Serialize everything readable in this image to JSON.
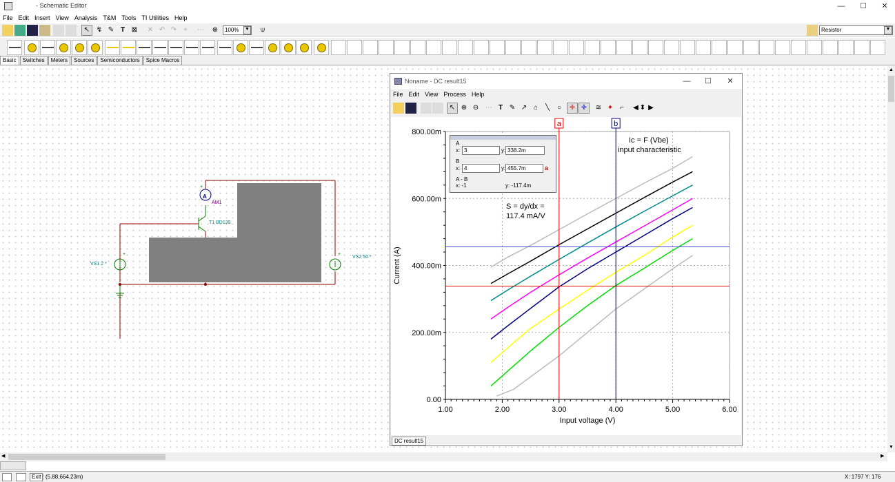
{
  "app": {
    "title": "- Schematic Editor",
    "window_controls": [
      "—",
      "☐",
      "✕"
    ]
  },
  "menu": [
    "File",
    "Edit",
    "Insert",
    "View",
    "Analysis",
    "T&M",
    "Tools",
    "TI Utilities",
    "Help"
  ],
  "toolbar": {
    "zoom": "100%",
    "component": "Resistor"
  },
  "component_tabs": [
    "Basic",
    "Switches",
    "Meters",
    "Sources",
    "Semiconductors",
    "Spice Macros"
  ],
  "schematic": {
    "ammeter_symbol": "A",
    "ammeter": "AM1",
    "transistor": "T1 BD139",
    "vs1": "VS1 2 *",
    "vs2": "VS2 50 *",
    "plus": "+"
  },
  "dc": {
    "title": "Noname - DC result15",
    "menu": [
      "File",
      "Edit",
      "View",
      "Process",
      "Help"
    ],
    "tab": "DC result15",
    "cursor": {
      "a_title": "A",
      "a_x_label": "x:",
      "a_x": "3",
      "a_y_label": "y:",
      "a_y": "338.2m",
      "b_title": "B",
      "b_x_label": "x:",
      "b_x": "4",
      "b_y_label": "y:",
      "b_y": "455.7m",
      "swap": "a",
      "d_title": "A - B",
      "d_x": "x:  -1",
      "d_y": "y:  -117.4m"
    },
    "annot_slope_1": "S = dy/dx =",
    "annot_slope_2": "117.4 mA/V",
    "annot_title_1": "Ic = F (Vbe)",
    "annot_title_2": "input characteristic",
    "cursor_a": "a",
    "cursor_b": "b"
  },
  "status": {
    "coords": "(5.88,664.23m)",
    "xy": "X: 1797  Y: 176",
    "exit": "Exit"
  },
  "chart_data": {
    "type": "line",
    "xlabel": "Input voltage (V)",
    "ylabel": "Current (A)",
    "xlim": [
      1,
      6
    ],
    "ylim": [
      0,
      0.8
    ],
    "x_ticks": [
      "1.00",
      "2.00",
      "3.00",
      "4.00",
      "5.00",
      "6.00"
    ],
    "y_ticks": [
      "0.00",
      "200.00m",
      "400.00m",
      "600.00m",
      "800.00m"
    ],
    "cursor_a_x": 3,
    "cursor_a_y": 0.3382,
    "cursor_b_x": 4,
    "cursor_b_y": 0.4557,
    "grid": true,
    "series": [
      {
        "color": "#bbbbbb",
        "x": [
          1.8,
          2.1,
          2.5,
          3.0,
          3.5,
          4.0,
          4.5,
          5.0,
          5.35
        ],
        "y": [
          0.395,
          0.425,
          0.46,
          0.507,
          0.554,
          0.6,
          0.646,
          0.69,
          0.725
        ]
      },
      {
        "color": "#000000",
        "x": [
          1.8,
          2.1,
          2.5,
          3.0,
          3.5,
          4.0,
          4.5,
          5.0,
          5.35
        ],
        "y": [
          0.346,
          0.375,
          0.413,
          0.462,
          0.509,
          0.556,
          0.603,
          0.649,
          0.68
        ]
      },
      {
        "color": "#008b8b",
        "x": [
          1.8,
          2.1,
          2.5,
          3.0,
          3.5,
          4.0,
          4.5,
          5.0,
          5.35
        ],
        "y": [
          0.295,
          0.327,
          0.368,
          0.418,
          0.467,
          0.515,
          0.562,
          0.608,
          0.64
        ]
      },
      {
        "color": "#ff00ff",
        "x": [
          1.8,
          2.1,
          2.5,
          3.0,
          3.5,
          4.0,
          4.5,
          5.0,
          5.35
        ],
        "y": [
          0.24,
          0.275,
          0.32,
          0.372,
          0.422,
          0.47,
          0.518,
          0.566,
          0.6
        ]
      },
      {
        "color": "#000080",
        "x": [
          1.8,
          2.1,
          2.5,
          3.0,
          3.5,
          4.0,
          4.5,
          5.0,
          5.35
        ],
        "y": [
          0.18,
          0.22,
          0.272,
          0.336,
          0.39,
          0.44,
          0.49,
          0.54,
          0.573
        ]
      },
      {
        "color": "#ffff00",
        "x": [
          1.8,
          2.1,
          2.5,
          3.0,
          3.5,
          4.0,
          4.5,
          5.0,
          5.35
        ],
        "y": [
          0.11,
          0.155,
          0.212,
          0.27,
          0.326,
          0.38,
          0.43,
          0.485,
          0.52
        ]
      },
      {
        "color": "#00dd00",
        "x": [
          1.8,
          2.1,
          2.5,
          3.0,
          3.5,
          4.0,
          4.5,
          5.0,
          5.35
        ],
        "y": [
          0.04,
          0.085,
          0.145,
          0.215,
          0.28,
          0.34,
          0.392,
          0.445,
          0.48
        ]
      },
      {
        "color": "#bbbbbb",
        "x": [
          1.9,
          2.2,
          2.6,
          3.0,
          3.5,
          4.0,
          4.5,
          5.0,
          5.35
        ],
        "y": [
          0.01,
          0.03,
          0.08,
          0.13,
          0.2,
          0.27,
          0.33,
          0.39,
          0.43
        ]
      }
    ]
  }
}
